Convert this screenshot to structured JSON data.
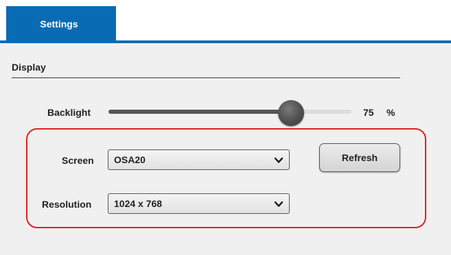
{
  "tabs": [
    {
      "label": "Settings",
      "active": true
    }
  ],
  "colors": {
    "tab_active": "#0a6bb5",
    "highlight": "#e02020"
  },
  "display": {
    "section_title": "Display",
    "backlight": {
      "label": "Backlight",
      "value": "75",
      "unit": "%",
      "level_fraction": 0.75
    },
    "screen": {
      "label": "Screen",
      "selected": "OSA20"
    },
    "resolution": {
      "label": "Resolution",
      "selected": "1024 x 768"
    },
    "refresh_label": "Refresh",
    "icons": {
      "dropdown": "chevron-down-icon",
      "slider_thumb": "slider-thumb"
    }
  }
}
